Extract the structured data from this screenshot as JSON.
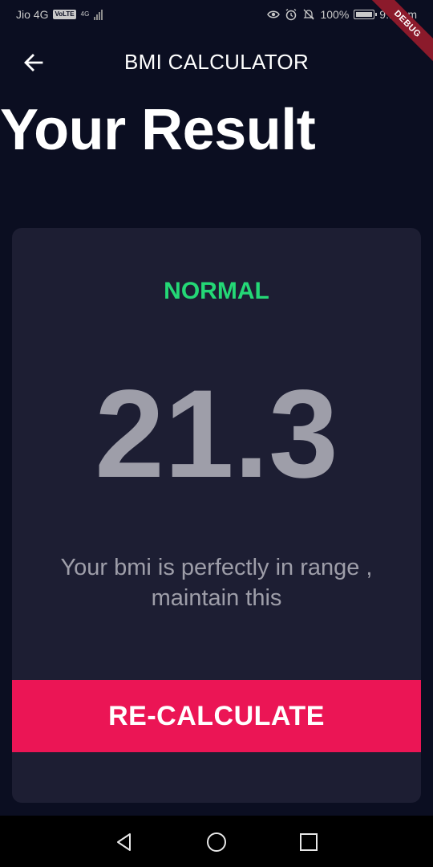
{
  "status_bar": {
    "carrier": "Jio 4G",
    "volte": "VoLTE",
    "network_type": "4G",
    "battery_percent": "100%",
    "time": "9:1_pm"
  },
  "debug_banner": "DEBUG",
  "app_bar": {
    "title": "BMI CALCULATOR",
    "back_icon": "arrow-left-icon"
  },
  "page": {
    "title": "Your Result"
  },
  "result": {
    "category": "NORMAL",
    "category_color": "#24d876",
    "bmi": "21.3",
    "message": "Your bmi is perfectly in range , maintain this"
  },
  "recalculate_button": {
    "label": "RE-CALCULATE",
    "color": "#eb1555"
  },
  "nav_bar": {
    "back_icon": "triangle-back-icon",
    "home_icon": "circle-home-icon",
    "recents_icon": "square-recents-icon"
  },
  "colors": {
    "background": "#0b0e21",
    "card": "#1d1e33",
    "muted_text": "#9e9ea9"
  }
}
